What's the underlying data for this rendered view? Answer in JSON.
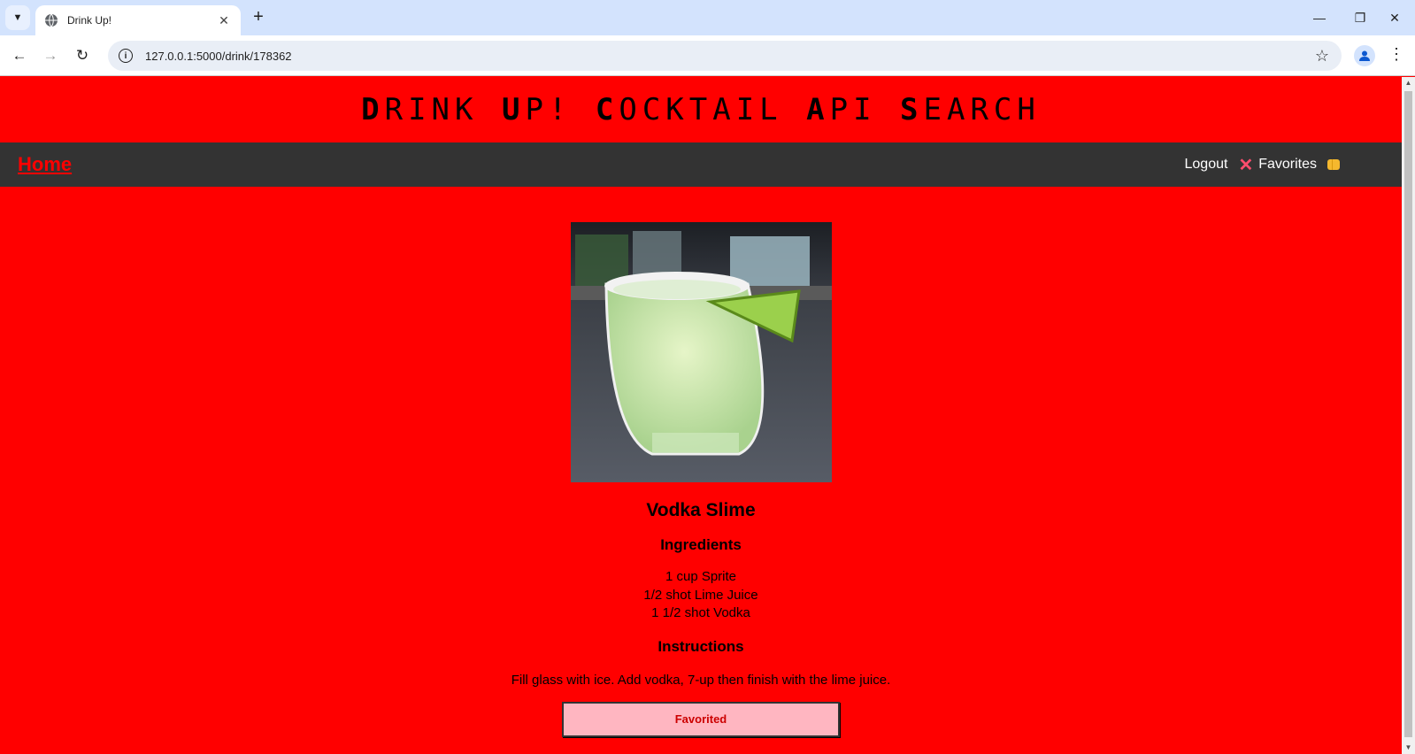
{
  "browser": {
    "tab_title": "Drink Up!",
    "url": "127.0.0.1:5000/drink/178362"
  },
  "site": {
    "title_parts": [
      "D",
      "RINK ",
      "U",
      "P! ",
      "C",
      "OCKTAIL ",
      "A",
      "PI ",
      "S",
      "EARCH"
    ],
    "nav": {
      "home": "Home",
      "logout": "Logout",
      "favorites": "Favorites"
    }
  },
  "drink": {
    "name": "Vodka Slime",
    "ingredients_heading": "Ingredients",
    "ingredients": [
      "1 cup Sprite",
      "1/2 shot Lime Juice",
      "1 1/2 shot Vodka"
    ],
    "instructions_heading": "Instructions",
    "instructions": "Fill glass with ice. Add vodka, 7-up then finish with the lime juice.",
    "favorite_button": "Favorited"
  },
  "colors": {
    "page_bg": "#ff0000",
    "nav_bg": "#333333",
    "home_link": "#ff0000",
    "fav_button_bg": "#ffb6c1",
    "fav_button_text": "#cc0000"
  }
}
